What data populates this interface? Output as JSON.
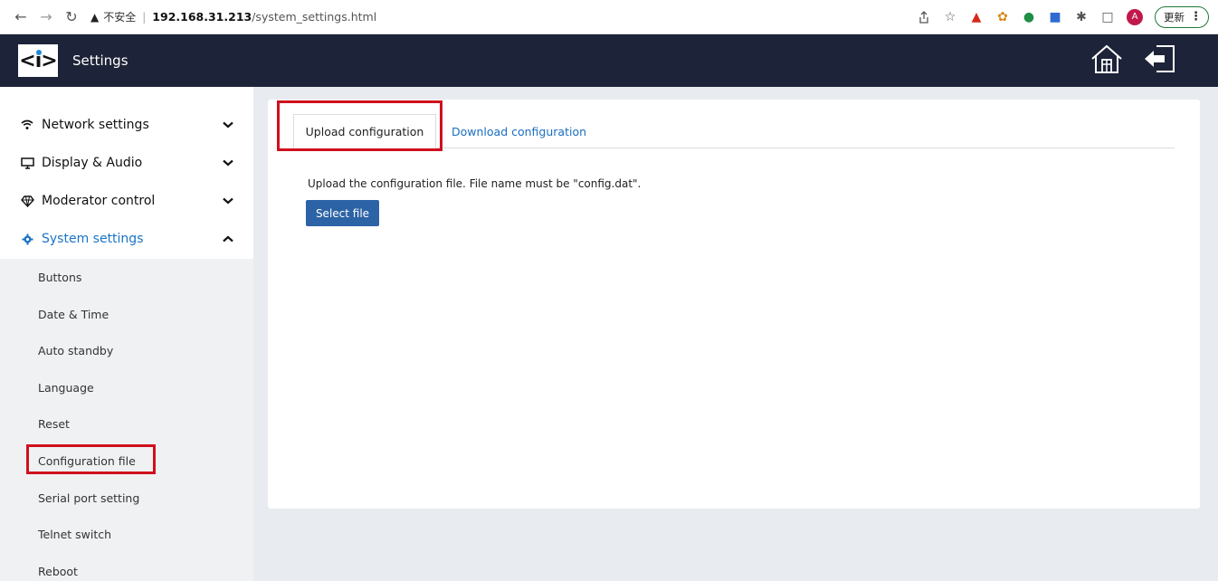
{
  "browser": {
    "security_label": "不安全",
    "url_host": "192.168.31.213",
    "url_path": "/system_settings.html",
    "avatar_letter": "A",
    "update_label": "更新"
  },
  "header": {
    "logo_text": "<i>",
    "title": "Settings"
  },
  "sidebar": {
    "groups": [
      {
        "label": "Network settings",
        "icon": "wifi-icon"
      },
      {
        "label": "Display & Audio",
        "icon": "monitor-icon"
      },
      {
        "label": "Moderator control",
        "icon": "diamond-icon"
      },
      {
        "label": "System settings",
        "icon": "gear-icon"
      }
    ],
    "items": [
      {
        "label": "Buttons"
      },
      {
        "label": "Date & Time"
      },
      {
        "label": "Auto standby"
      },
      {
        "label": "Language"
      },
      {
        "label": "Reset"
      },
      {
        "label": "Configuration file"
      },
      {
        "label": "Serial port setting"
      },
      {
        "label": "Telnet switch"
      },
      {
        "label": "Reboot"
      }
    ]
  },
  "main": {
    "tabs": [
      {
        "label": "Upload configuration"
      },
      {
        "label": "Download configuration"
      }
    ],
    "description": "Upload the configuration file. File name must be \"config.dat\".",
    "select_button": "Select file"
  },
  "colors": {
    "header_bg": "#1d2338",
    "accent_blue": "#1a73c8",
    "button_blue": "#2c63a6",
    "highlight_red": "#d0101d"
  }
}
